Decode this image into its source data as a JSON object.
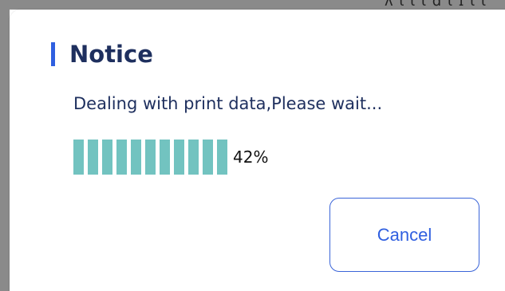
{
  "background": {
    "fragment_text": "ʌ ɩ ɩ ɩ ɑ ɩ ɪ ɩ ɩ"
  },
  "dialog": {
    "title": "Notice",
    "message": "Dealing with print data,Please wait...",
    "progress": {
      "percent_label": "42%",
      "value": 0.42
    },
    "cancel_label": "Cancel"
  },
  "colors": {
    "accent": "#2f5fe0",
    "title_text": "#1e2f5e",
    "progress_fill": "#72c3c0"
  }
}
